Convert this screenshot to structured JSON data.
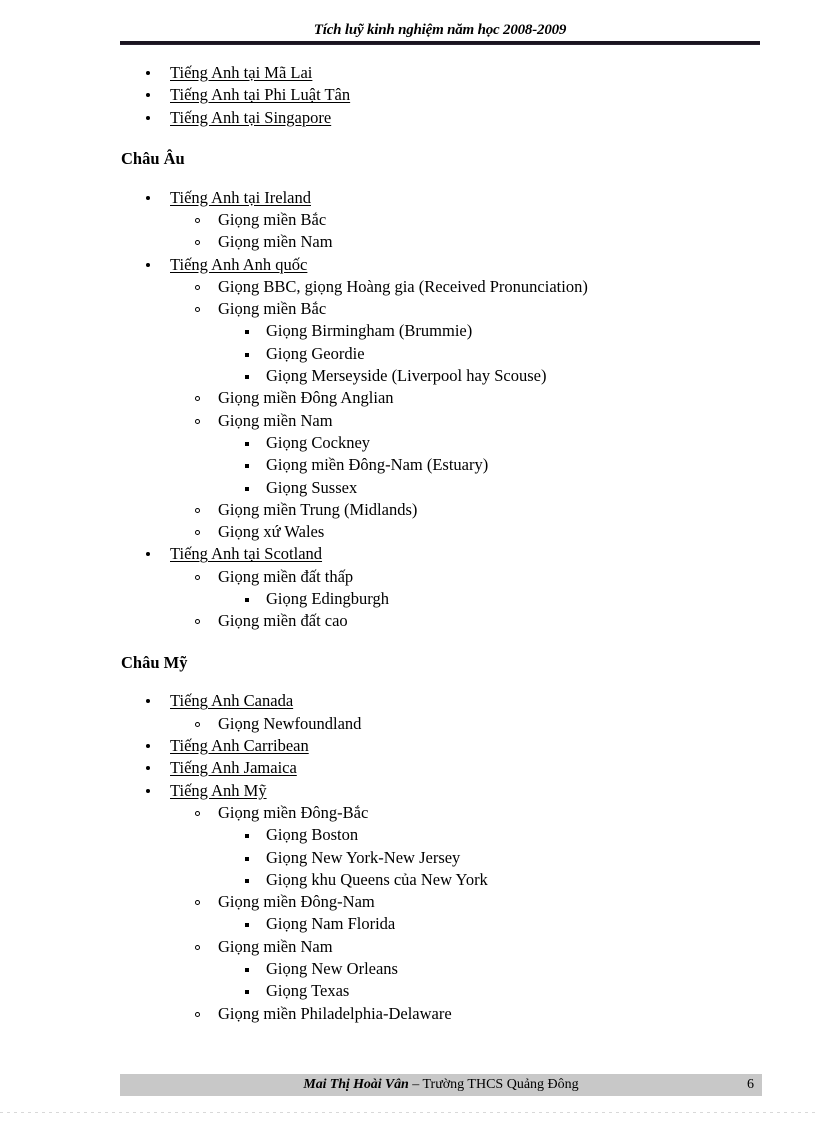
{
  "header": {
    "title": "Tích luỹ kinh nghiệm năm học 2008-2009"
  },
  "footer": {
    "author": "Mai Thị Hoài Vân",
    "school": " – Trường  THCS Quảng Đông",
    "page_number": "6"
  },
  "sections": {
    "asia_tail": {
      "items": [
        "Tiếng Anh tại Mã Lai",
        "Tiếng Anh tại Phi Luật Tân",
        "Tiếng Anh tại Singapore"
      ]
    },
    "europe": {
      "heading": "Châu Âu",
      "ireland": {
        "label": "Tiếng Anh tại Ireland",
        "sub": [
          "Giọng miền Bắc",
          "Giọng miền Nam"
        ]
      },
      "uk": {
        "label": "Tiếng Anh Anh quốc",
        "rp": "Giọng BBC, giọng Hoàng gia  (Received Pronunciation)",
        "north": "Giọng miền Bắc",
        "north_sub": [
          "Giọng Birmingham  (Brummie)",
          "Giọng Geordie",
          "Giọng Merseyside (Liverpool hay Scouse)"
        ],
        "east_anglian": "Giọng miền Đông Anglian",
        "south": "Giọng miền Nam",
        "south_sub": [
          "Giọng Cockney",
          "Giọng miền Đông-Nam (Estuary)",
          "Giọng Sussex"
        ],
        "midlands": "Giọng miền Trung (Midlands)",
        "wales": "Giọng xứ Wales"
      },
      "scotland": {
        "label": "Tiếng Anh tại Scotland",
        "lowland": "Giọng miền đất thấp",
        "lowland_sub": [
          "Giọng Edingburgh"
        ],
        "highland": "Giọng miền đất cao"
      }
    },
    "america": {
      "heading": "Châu Mỹ",
      "canada": {
        "label": "Tiếng Anh Canada",
        "sub": [
          "Giọng Newfoundland"
        ]
      },
      "caribbean": "Tiếng Anh Carribean",
      "jamaica": "Tiếng Anh Jamaica",
      "usa": {
        "label": "Tiếng Anh Mỹ",
        "northeast": "Giọng miền Đông-Bắc",
        "northeast_sub": [
          "Giọng Boston",
          "Giọng New York-New Jersey",
          "Giọng khu Queens của New York"
        ],
        "southeast": "Giọng miền Đông-Nam",
        "southeast_sub": [
          "Giọng Nam Florida"
        ],
        "south": "Giọng miền Nam",
        "south_sub": [
          "Giọng New Orleans",
          "Giọng Texas"
        ],
        "philadelphia": "Giọng miền Philadelphia-Delaware"
      }
    }
  }
}
